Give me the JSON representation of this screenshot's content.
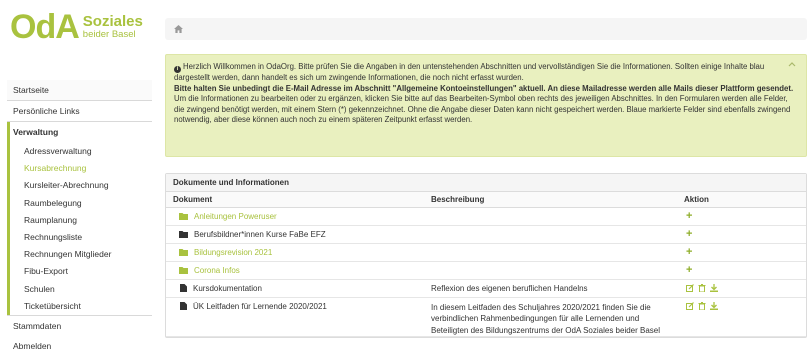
{
  "brand": {
    "mark": "OdA",
    "line1": "Soziales",
    "line2": "beider Basel",
    "color": "#a9c23f"
  },
  "nav": {
    "startseite": "Startseite",
    "persoenliche_links": "Persönliche Links",
    "verwaltung": "Verwaltung",
    "sub_items": [
      {
        "label": "Adressverwaltung",
        "active": false
      },
      {
        "label": "Kursabrechnung",
        "active": true
      },
      {
        "label": "Kursleiter-Abrechnung",
        "active": false
      },
      {
        "label": "Raumbelegung",
        "active": false
      },
      {
        "label": "Raumplanung",
        "active": false
      },
      {
        "label": "Rechnungsliste",
        "active": false
      },
      {
        "label": "Rechnungen Mitglieder",
        "active": false
      },
      {
        "label": "Fibu-Export",
        "active": false
      },
      {
        "label": "Schulen",
        "active": false
      },
      {
        "label": "Ticketübersicht",
        "active": false
      }
    ],
    "stammdaten": "Stammdaten",
    "abmelden": "Abmelden"
  },
  "breadcrumb": {
    "icon": "home-icon"
  },
  "alert": {
    "intro": "Herzlich Willkommen in OdaOrg. Bitte prüfen Sie die Angaben in den untenstehenden Abschnitten und vervollständigen Sie die Informationen. Sollten einige Inhalte blau dargestellt werden, dann handelt es sich um zwingende Informationen, die noch nicht erfasst wurden.",
    "bold": "Bitte halten Sie unbedingt die E-Mail Adresse im Abschnitt \"Allgemeine Kontoeinstellungen\" aktuell. An diese Mailadresse werden alle Mails dieser Plattform gesendet.",
    "outro": "Um die Informationen zu bearbeiten oder zu ergänzen, klicken Sie bitte auf das Bearbeiten-Symbol oben rechts des jeweiligen Abschnittes. In den Formularen werden alle Felder, die zwingend benötigt werden, mit einem Stern (*) gekennzeichnet. Ohne die Angabe dieser Daten kann nicht gespeichert werden. Blaue markierte Felder sind ebenfalls zwingend notwendig, aber diese können auch noch zu einem späteren Zeitpunkt erfasst werden."
  },
  "panel": {
    "title": "Dokumente und Informationen",
    "columns": [
      "Dokument",
      "Beschreibung",
      "Aktion"
    ],
    "rows": [
      {
        "name": "Anleitungen Poweruser",
        "type": "folder",
        "link": true,
        "description": "",
        "action": "add"
      },
      {
        "name": "Berufsbildner*innen Kurse FaBe EFZ",
        "type": "folder",
        "link": false,
        "description": "",
        "action": "add"
      },
      {
        "name": "Bildungsrevision 2021",
        "type": "folder",
        "link": true,
        "description": "",
        "action": "add"
      },
      {
        "name": "Corona Infos",
        "type": "folder",
        "link": true,
        "description": "",
        "action": "add"
      },
      {
        "name": "Kursdokumentation",
        "type": "file",
        "link": false,
        "description": "Reflexion des eigenen beruflichen Handelns",
        "action": "edit-delete-download"
      },
      {
        "name": "ÜK Leitfaden für Lernende 2020/2021",
        "type": "file",
        "link": false,
        "description": "In diesem Leitfaden des Schuljahres 2020/2021 finden Sie die verbindlichen Rahmenbedingungen für alle Lernenden und Beteiligten des Bildungszentrums der OdA Soziales beider Basel",
        "action": "edit-delete-download"
      }
    ]
  }
}
